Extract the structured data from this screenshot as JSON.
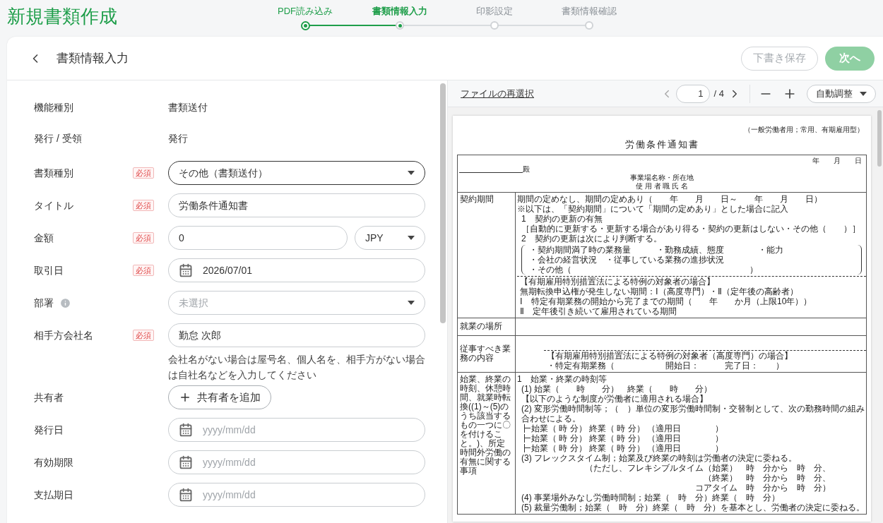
{
  "app_title": "新規書類作成",
  "steps": [
    {
      "label": "PDF読み込み",
      "done": true,
      "selected": false
    },
    {
      "label": "書類情報入力",
      "done": false,
      "selected": true
    },
    {
      "label": "印影設定",
      "done": false,
      "selected": false
    },
    {
      "label": "書類情報確認",
      "done": false,
      "selected": false
    }
  ],
  "header": {
    "title": "書類情報入力",
    "buttons": [
      {
        "label": "下書き保存",
        "kind": "outline",
        "disabled": true
      },
      {
        "label": "次へ",
        "kind": "primary",
        "disabled": true
      }
    ]
  },
  "fields": [
    {
      "label": "機能種別",
      "kind": "text",
      "value": "書類送付"
    },
    {
      "label": "発行 / 受領",
      "kind": "text",
      "value": "発行"
    },
    {
      "label": "書類種別",
      "badge": "必須",
      "kind": "select",
      "value": "その他（書類送付）",
      "focused": true
    },
    {
      "label": "タイトル",
      "badge": "必須",
      "kind": "input",
      "value": "労働条件通知書"
    },
    {
      "label": "金額",
      "badge": "必須",
      "kind": "amount",
      "value": "0",
      "currency": "JPY"
    },
    {
      "label": "取引日",
      "badge": "必須",
      "kind": "date",
      "value": "2026/07/01"
    },
    {
      "label": "部署",
      "info": true,
      "kind": "select",
      "placeholder": "未選択"
    },
    {
      "label": "相手方会社名",
      "badge": "必須",
      "kind": "input",
      "value": "勤怠 次郎",
      "hint": "会社名がない場合は屋号名、個人名を、相手方がない場合は自社名などを入力してください"
    },
    {
      "label": "共有者",
      "kind": "add",
      "button": "共有者を追加"
    },
    {
      "label": "発行日",
      "kind": "date",
      "placeholder": "yyyy/mm/dd"
    },
    {
      "label": "有効期限",
      "kind": "date",
      "placeholder": "yyyy/mm/dd"
    },
    {
      "label": "支払期日",
      "kind": "date",
      "placeholder": "yyyy/mm/dd"
    }
  ],
  "viewer": {
    "reselect_link": "ファイルの再選択",
    "page": "1",
    "page_total": "/ 4",
    "zoom": "自動調整"
  },
  "document": {
    "note": "（一般労働者用；常用、有期雇用型）",
    "title": "労働条件通知書",
    "date": "年　　月　　日",
    "addressee": "殿",
    "employer_lines": [
      "事業場名称・所在地",
      "使 用 者 職 氏 名"
    ],
    "sections": [
      {
        "heading": "契約期間",
        "lines": [
          {
            "kind": "plain",
            "text": "期間の定めなし、期間の定めあり（　　年　　月　　日～　　年　　月　　日）"
          },
          {
            "kind": "plain",
            "text": "※以下は、「契約期間」について「期間の定めあり」とした場合に記入"
          },
          {
            "kind": "indent",
            "text": "1　契約の更新の有無"
          },
          {
            "kind": "indent",
            "text": "［自動的に更新する・更新する場合があり得る・契約の更新はしない・その他（　　）］"
          },
          {
            "kind": "indent",
            "text": "2　契約の更新は次により判断する。"
          },
          {
            "kind": "bracket",
            "text": "・契約期間満了時の業務量　　　・勤務成績、態度　　　　・能力"
          },
          {
            "kind": "bracket",
            "text": "・会社の経営状況　・従事している業務の進捗状況"
          },
          {
            "kind": "bracket",
            "text": "・その他（　　　　　　　　　　　　　　　　　　　　　）"
          },
          {
            "kind": "note",
            "text": "【有期雇用特別措置法による特例の対象者の場合】"
          },
          {
            "kind": "note",
            "text": "無期転換申込権が発生しない期間：Ⅰ（高度専門）・Ⅱ（定年後の高齢者）"
          },
          {
            "kind": "note",
            "text": "Ⅰ　特定有期業務の開始から完了までの期間（　　年　　か月（上限10年））"
          },
          {
            "kind": "note",
            "text": "Ⅱ　定年後引き続いて雇用されている期間"
          }
        ]
      },
      {
        "heading": "就業の場所"
      },
      {
        "heading": "従事すべき業務の内容",
        "lines": [
          {
            "kind": "note",
            "text": "【有期雇用特別措置法による特例の対象者（高度専門）の場合】"
          },
          {
            "kind": "note",
            "text": "・特定有期業務（　　　　　　開始日：　　　完了日：　　）"
          }
        ]
      },
      {
        "heading": "始業、終業の時刻、休憩時間、就業時転換((1)～(5)のうち該当するもの一つに〇を付けること。)、所定時間外労働の有無に関する事項",
        "lines": [
          {
            "kind": "plain",
            "text": "1　始業・終業の時刻等"
          },
          {
            "kind": "indent",
            "text": "(1) 始業（　　時　　分）　終業（　　時　　分）"
          },
          {
            "kind": "indent",
            "text": "【以下のような制度が労働者に適用される場合】"
          },
          {
            "kind": "indent",
            "text": "(2) 変形労働時間制等；（　）単位の変形労働時間制・交替制として、次の勤務時間の組み合わせによる。"
          },
          {
            "kind": "tree",
            "text": "始業（ 時 分） 終業（ 時 分） （適用日　　　　）"
          },
          {
            "kind": "tree",
            "text": "始業（ 時 分） 終業（ 時 分） （適用日　　　　）"
          },
          {
            "kind": "tree",
            "text": "始業（ 時 分） 終業（ 時 分） （適用日　　　　）"
          },
          {
            "kind": "indent",
            "text": "(3) フレックスタイム制；始業及び終業の時刻は労働者の決定に委ねる。"
          },
          {
            "kind": "deep",
            "text": "（ただし、フレキシブルタイム（始業）　時　分から　時　分、"
          },
          {
            "kind": "deep",
            "text": "（終業）　時　分から　時　分、"
          },
          {
            "kind": "deep",
            "text": "コアタイム　時　分から　時　分）"
          },
          {
            "kind": "indent",
            "text": "(4) 事業場外みなし労働時間制；始業（　時　分）終業（　時　分）"
          },
          {
            "kind": "indent",
            "text": "(5) 裁量労働制；始業（　時　分）終業（　時　分）を基本とし、労働者の決定に委ねる。"
          }
        ]
      }
    ]
  }
}
